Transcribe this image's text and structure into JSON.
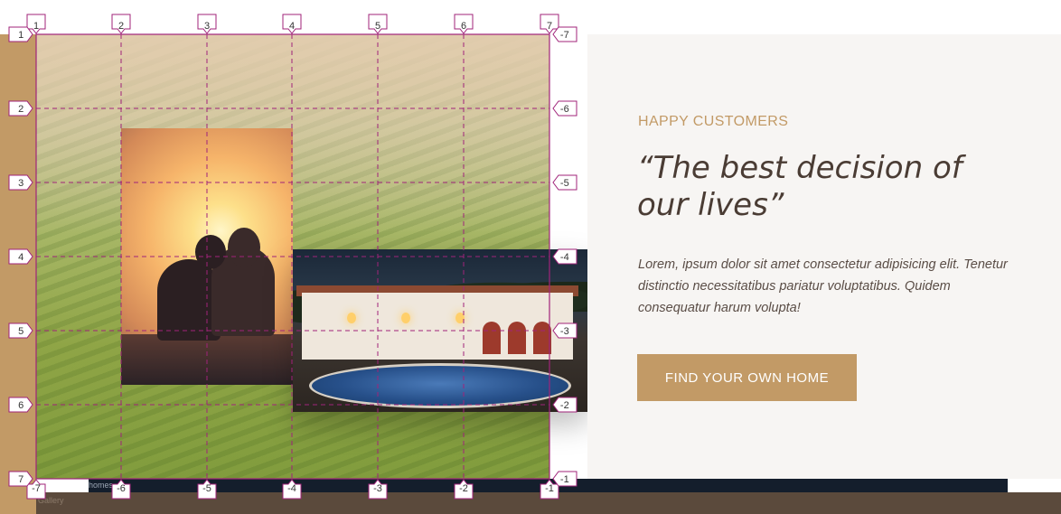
{
  "section": {
    "kicker": "HAPPY CUSTOMERS",
    "quote": "“The best decision of our lives”",
    "body": "Lorem, ipsum dolor sit amet consectetur adipisicing elit. Tenetur distinctio necessitatibus pariatur voluptatibus. Quidem consequatur harum volupta!",
    "cta_label": "FIND YOUR OWN HOME"
  },
  "bottom": {
    "crumb_top": "homes",
    "crumb_bottom": "Gallery"
  },
  "grid_overlay": {
    "top_labels": [
      "1",
      "2",
      "3",
      "4",
      "5",
      "6",
      "7"
    ],
    "bottom_labels": [
      "-7",
      "-6",
      "-5",
      "-4",
      "-3",
      "-2",
      "-1"
    ],
    "left_labels": [
      "1",
      "2",
      "3",
      "4",
      "5",
      "6",
      "7"
    ],
    "right_labels": [
      "-7",
      "-6",
      "-5",
      "-4",
      "-3",
      "-2",
      "-1"
    ],
    "line_color": "#a0237a"
  },
  "colors": {
    "accent": "#c29a66",
    "heading": "#4a3c34",
    "panel_bg": "#f7f5f3"
  }
}
